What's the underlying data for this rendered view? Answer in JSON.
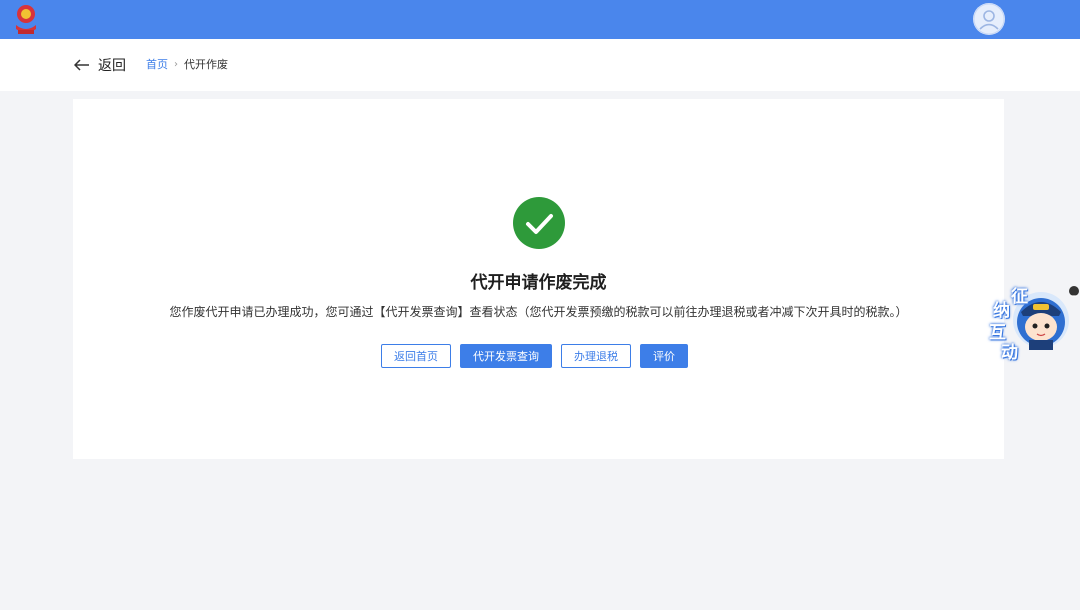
{
  "header": {
    "logo_icon": "tax-emblem-icon",
    "avatar_icon": "user-avatar-icon",
    "brand_color": "#4a86ec"
  },
  "subnav": {
    "back_label": "返回",
    "breadcrumb": {
      "home": "首页",
      "current": "代开作废"
    }
  },
  "result": {
    "status_icon": "success-check-icon",
    "status_color": "#2e9a3a",
    "title": "代开申请作废完成",
    "description": "您作废代开申请已办理成功，您可通过【代开发票查询】查看状态（您代开发票预缴的税款可以前往办理退税或者冲减下次开具时的税款。）",
    "buttons": {
      "home": "返回首页",
      "invoice_query": "代开发票查询",
      "refund": "办理退税",
      "rate": "评价"
    }
  },
  "assistant_widget": {
    "chars": [
      "征",
      "纳",
      "互",
      "动"
    ]
  }
}
